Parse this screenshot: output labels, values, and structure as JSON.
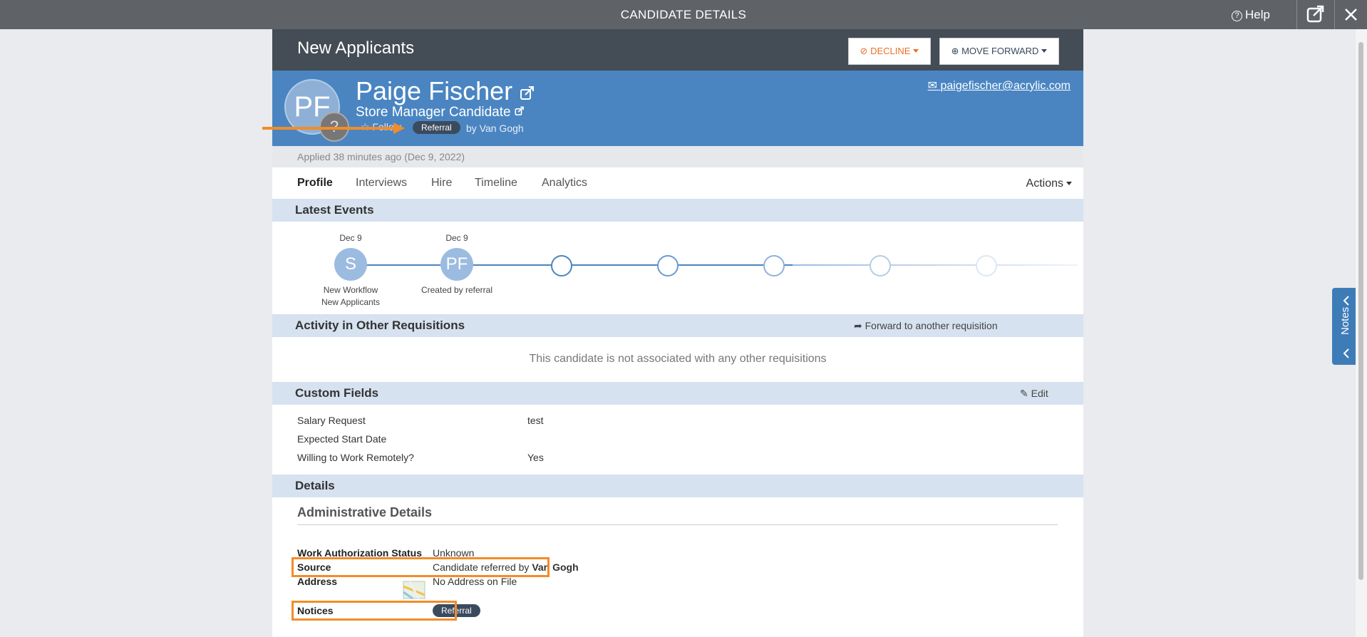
{
  "topbar": {
    "title": "CANDIDATE DETAILS",
    "help": "Help"
  },
  "stage": {
    "name": "New Applicants",
    "decline": "DECLINE",
    "move_forward": "MOVE FORWARD"
  },
  "candidate": {
    "initials": "PF",
    "name": "Paige Fischer",
    "role": "Store Manager Candidate",
    "follow": "Follow",
    "badge": "Referral",
    "byline": "by Van Gogh",
    "email": "paigefischer@acrylic.com"
  },
  "applied": "Applied 38 minutes ago (Dec 9, 2022)",
  "tabs": [
    "Profile",
    "Interviews",
    "Hire",
    "Timeline",
    "Analytics"
  ],
  "actions": "Actions",
  "latest_events": {
    "title": "Latest Events",
    "events": [
      {
        "date": "Dec 9",
        "initials": "S",
        "caption1": "New Workflow",
        "caption2": "New Applicants"
      },
      {
        "date": "Dec 9",
        "initials": "PF",
        "caption1": "Created by referral",
        "caption2": ""
      }
    ]
  },
  "activity": {
    "title": "Activity in Other Requisitions",
    "forward": "Forward to another requisition",
    "empty": "This candidate is not associated with any other requisitions"
  },
  "custom_fields": {
    "title": "Custom Fields",
    "edit": "Edit",
    "rows": [
      {
        "label": "Salary Request",
        "value": "test"
      },
      {
        "label": "Expected Start Date",
        "value": ""
      },
      {
        "label": "Willing to Work Remotely?",
        "value": "Yes"
      }
    ]
  },
  "details": {
    "title": "Details",
    "admin_title": "Administrative Details",
    "work_auth_label": "Work Authorization Status",
    "work_auth_value": "Unknown",
    "source_label": "Source",
    "source_prefix": "Candidate referred by ",
    "source_name": "Van Gogh",
    "address_label": "Address",
    "address_value": "No Address on File",
    "notices_label": "Notices",
    "notices_badge": "Referral"
  },
  "notes_tab": "Notes",
  "colors": {
    "accent": "#4a85c2",
    "highlight": "#f28c28",
    "stagebar": "#444c55"
  }
}
